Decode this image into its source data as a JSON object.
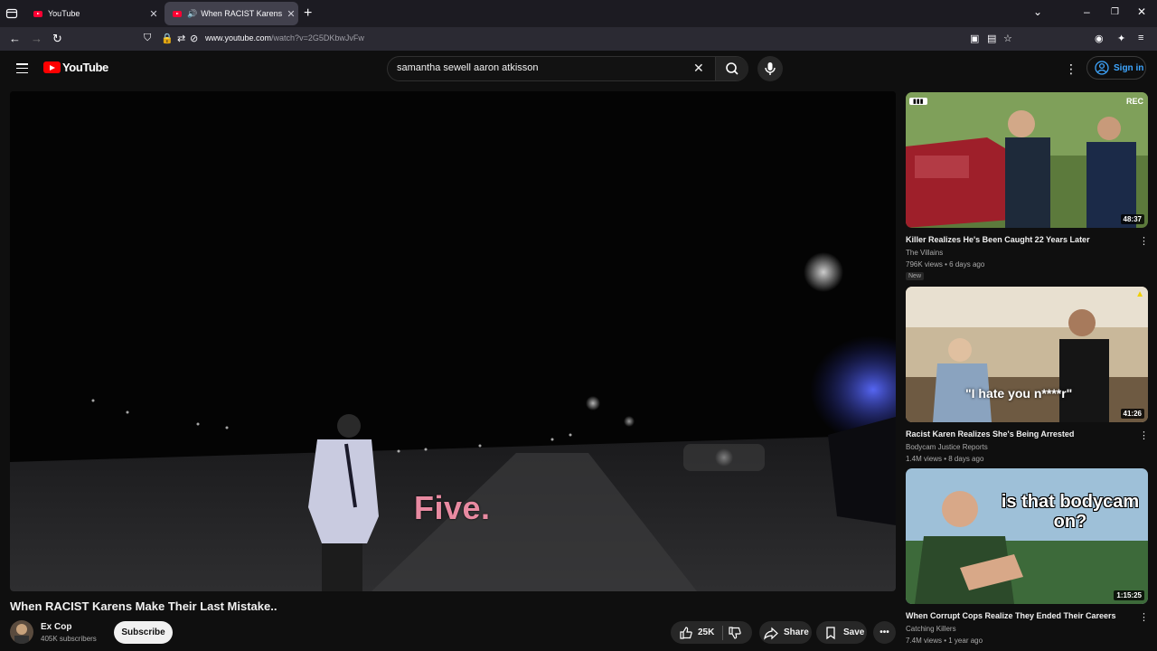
{
  "browser": {
    "tabs": [
      {
        "title": "YouTube"
      },
      {
        "title": "When RACIST Karens Make"
      }
    ],
    "url_domain": "www.youtube.com",
    "url_rest": "/watch?v=2G5DKbwJvFw"
  },
  "header": {
    "logo_text": "YouTube",
    "search_value": "samantha sewell aaron atkisson",
    "signin_label": "Sign in"
  },
  "video": {
    "caption": "Five.",
    "title": "When RACIST Karens Make Their Last Mistake..",
    "channel": "Ex Cop",
    "subscribers": "405K subscribers",
    "subscribe_label": "Subscribe",
    "likes": "25K",
    "share_label": "Share",
    "save_label": "Save"
  },
  "recommendations": [
    {
      "title": "Killer Realizes He's Been Caught 22 Years Later",
      "channel": "The Villains",
      "meta": "796K views • 6 days ago",
      "badge": "New",
      "duration": "48:37",
      "overlay": "REC"
    },
    {
      "title": "Racist Karen Realizes She's Being Arrested",
      "channel": "Bodycam Justice Reports",
      "meta": "1.4M views • 8 days ago",
      "duration": "41:26",
      "overlay": "\"I hate you n****r\""
    },
    {
      "title": "When Corrupt Cops Realize They Ended Their Careers",
      "channel": "Catching Killers",
      "meta": "7.4M views • 1 year ago",
      "duration": "1:15:25",
      "overlay": "is that bodycam on?"
    }
  ]
}
